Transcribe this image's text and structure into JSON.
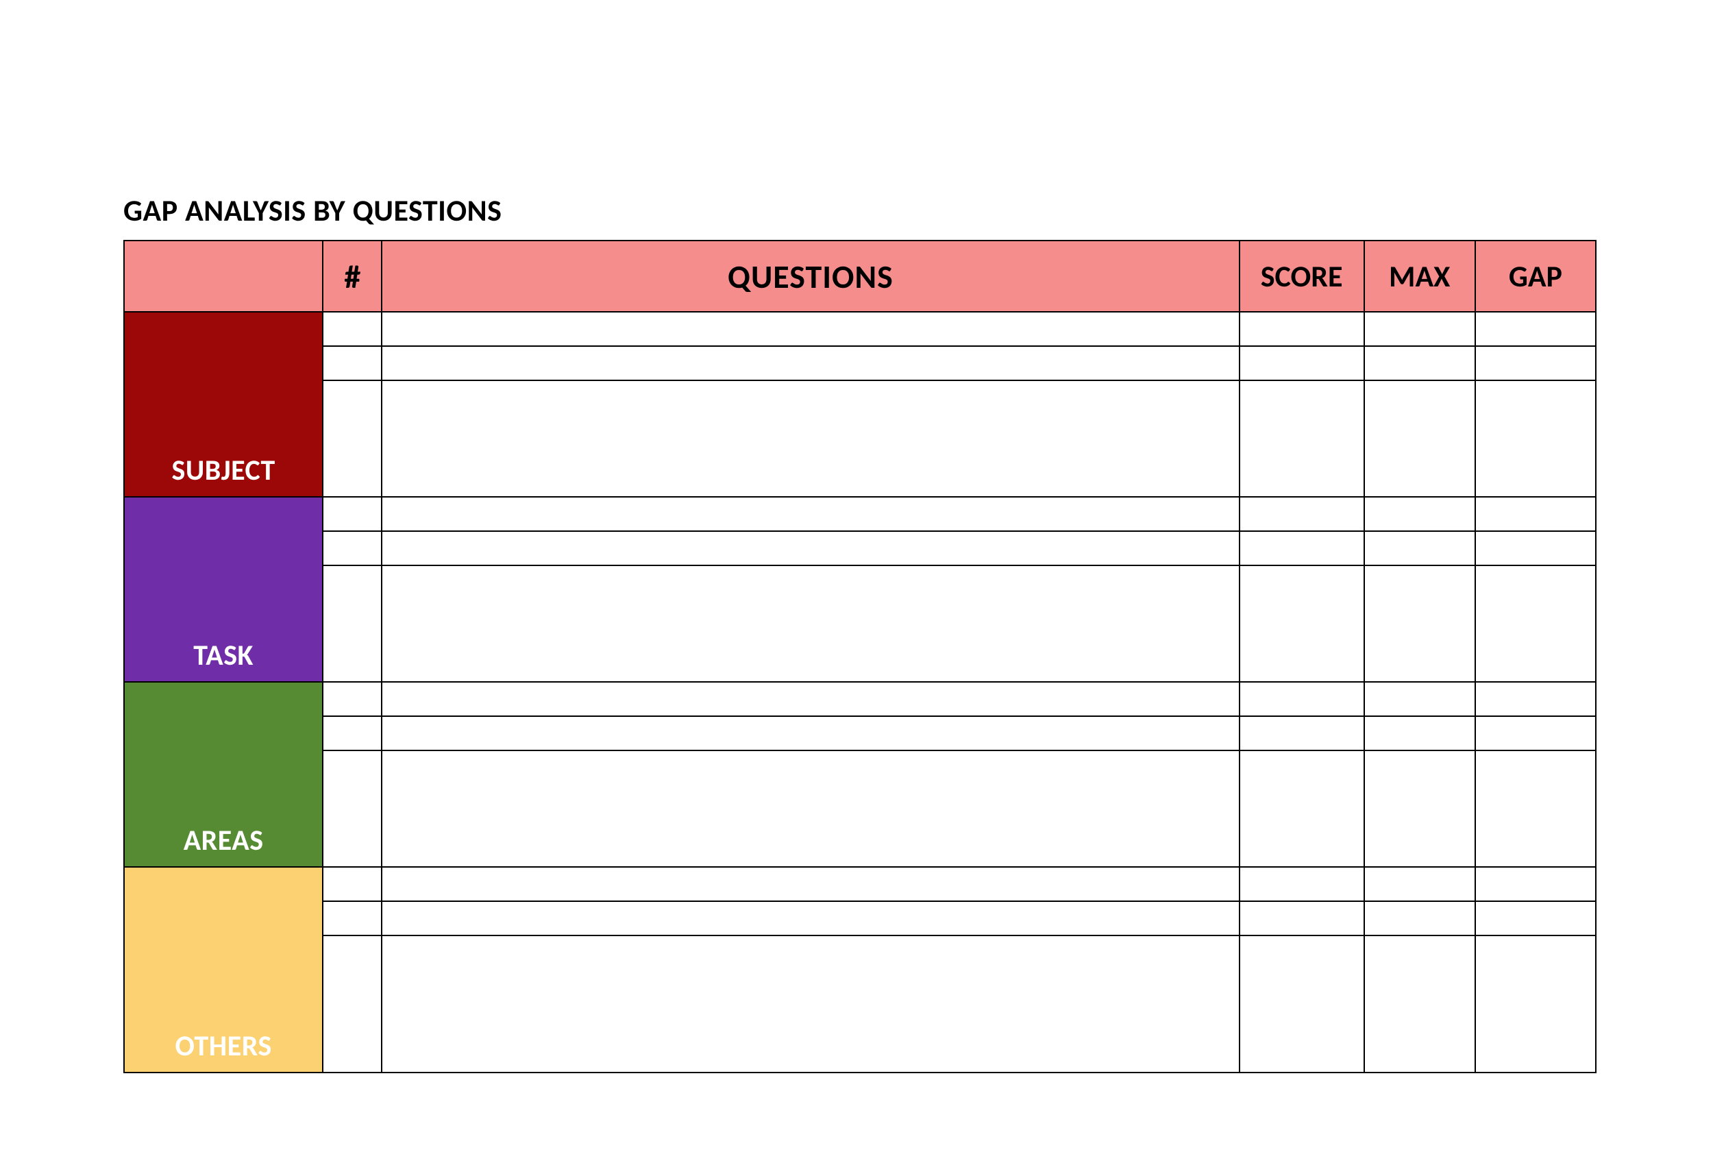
{
  "title": "GAP ANALYSIS BY QUESTIONS",
  "header": {
    "blank": "",
    "num": "#",
    "questions": "QUESTIONS",
    "score": "SCORE",
    "max": "MAX",
    "gap": "GAP"
  },
  "sections": [
    {
      "label": "SUBJECT",
      "rows": [
        {
          "num": "",
          "question": "",
          "score": "",
          "max": "",
          "gap": ""
        },
        {
          "num": "",
          "question": "",
          "score": "",
          "max": "",
          "gap": ""
        },
        {
          "num": "",
          "question": "",
          "score": "",
          "max": "",
          "gap": ""
        }
      ]
    },
    {
      "label": "TASK",
      "rows": [
        {
          "num": "",
          "question": "",
          "score": "",
          "max": "",
          "gap": ""
        },
        {
          "num": "",
          "question": "",
          "score": "",
          "max": "",
          "gap": ""
        },
        {
          "num": "",
          "question": "",
          "score": "",
          "max": "",
          "gap": ""
        }
      ]
    },
    {
      "label": "AREAS",
      "rows": [
        {
          "num": "",
          "question": "",
          "score": "",
          "max": "",
          "gap": ""
        },
        {
          "num": "",
          "question": "",
          "score": "",
          "max": "",
          "gap": ""
        },
        {
          "num": "",
          "question": "",
          "score": "",
          "max": "",
          "gap": ""
        }
      ]
    },
    {
      "label": "OTHERS",
      "rows": [
        {
          "num": "",
          "question": "",
          "score": "",
          "max": "",
          "gap": ""
        },
        {
          "num": "",
          "question": "",
          "score": "",
          "max": "",
          "gap": ""
        },
        {
          "num": "",
          "question": "",
          "score": "",
          "max": "",
          "gap": ""
        }
      ]
    }
  ]
}
